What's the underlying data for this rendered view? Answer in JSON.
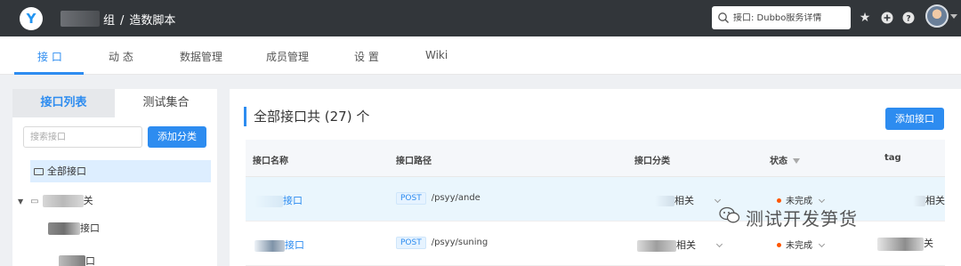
{
  "header": {
    "logo_letter": "Y",
    "breadcrumb_group": "组",
    "breadcrumb_sep": "/",
    "breadcrumb_project": "造数脚本",
    "search_placeholder": "接口: Dubbo服务详情",
    "icons": [
      "star-icon",
      "plus-circle-icon",
      "question-circle-icon",
      "avatar"
    ]
  },
  "nav": {
    "tabs": [
      {
        "label": "接 口",
        "active": true
      },
      {
        "label": "动 态",
        "active": false
      },
      {
        "label": "数据管理",
        "active": false
      },
      {
        "label": "成员管理",
        "active": false
      },
      {
        "label": "设 置",
        "active": false
      },
      {
        "label": "Wiki",
        "active": false
      }
    ]
  },
  "sidebar": {
    "tabs": [
      {
        "label": "接口列表",
        "active": true
      },
      {
        "label": "测试集合",
        "active": false
      }
    ],
    "search_placeholder": "搜索接口",
    "add_category_label": "添加分类",
    "all_label": "全部接口",
    "tree": [
      {
        "label": "关"
      },
      {
        "label": "接口"
      },
      {
        "label": "口"
      }
    ]
  },
  "main": {
    "title": "全部接口共 (27) 个",
    "add_api_label": "添加接口",
    "columns": [
      "接口名称",
      "接口路径",
      "接口分类",
      "状态",
      "tag"
    ],
    "rows": [
      {
        "name": "接口",
        "method": "POST",
        "path": "/psyy/ande",
        "category": "相关",
        "status": "未完成",
        "tag": "相关"
      },
      {
        "name": "接口",
        "method": "POST",
        "path": "/psyy/suning",
        "category": "相关",
        "status": "未完成",
        "tag": "关"
      }
    ]
  },
  "watermark": {
    "text": "测试开发笋货"
  },
  "colors": {
    "accent": "#2d8cf0",
    "topbar": "#32363a",
    "status_dot": "#ff5500"
  }
}
